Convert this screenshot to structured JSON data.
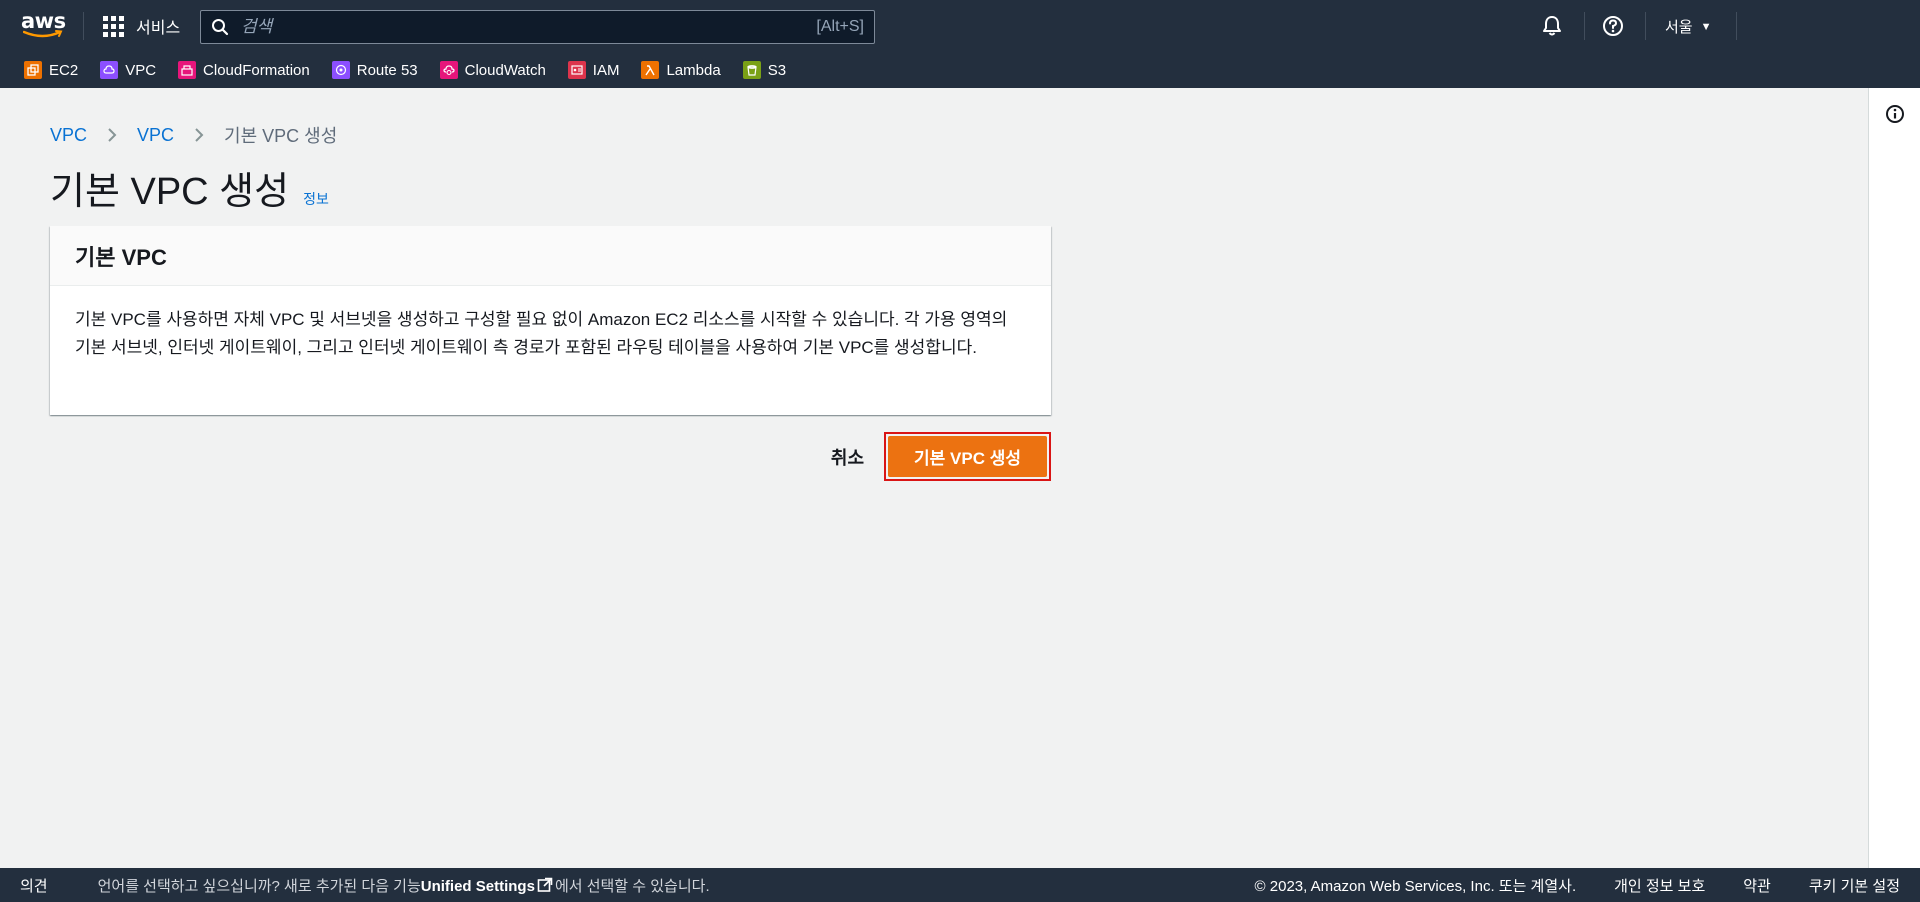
{
  "topnav": {
    "logo_text": "aws",
    "services_label": "서비스",
    "search_placeholder": "검색",
    "search_shortcut": "[Alt+S]",
    "region_label": "서울"
  },
  "favorites": [
    {
      "label": "EC2",
      "color": "#ed7100",
      "icon": "ec2-icon"
    },
    {
      "label": "VPC",
      "color": "#8c4fff",
      "icon": "vpc-icon"
    },
    {
      "label": "CloudFormation",
      "color": "#e7157b",
      "icon": "cloudformation-icon"
    },
    {
      "label": "Route 53",
      "color": "#8c4fff",
      "icon": "route53-icon"
    },
    {
      "label": "CloudWatch",
      "color": "#e7157b",
      "icon": "cloudwatch-icon"
    },
    {
      "label": "IAM",
      "color": "#dd344c",
      "icon": "iam-icon"
    },
    {
      "label": "Lambda",
      "color": "#ed7100",
      "icon": "lambda-icon"
    },
    {
      "label": "S3",
      "color": "#7aa116",
      "icon": "s3-icon"
    }
  ],
  "breadcrumb": {
    "items": [
      "VPC",
      "VPC"
    ],
    "current": "기본 VPC 생성"
  },
  "page": {
    "title": "기본 VPC 생성",
    "info_link": "정보"
  },
  "panel": {
    "header": "기본 VPC",
    "body": "기본 VPC를 사용하면 자체 VPC 및 서브넷을 생성하고 구성할 필요 없이 Amazon EC2 리소스를 시작할 수 있습니다. 각 가용 영역의 기본 서브넷, 인터넷 게이트웨이, 그리고 인터넷 게이트웨이 측 경로가 포함된 라우팅 테이블을 사용하여 기본 VPC를 생성합니다."
  },
  "actions": {
    "cancel": "취소",
    "primary": "기본 VPC 생성"
  },
  "footer": {
    "feedback": "의견",
    "lang_prefix": "언어를 선택하고 싶으십니까? 새로 추가된 다음 기능",
    "lang_link": "Unified Settings",
    "lang_suffix": "에서 선택할 수 있습니다.",
    "copyright": "© 2023, Amazon Web Services, Inc. 또는 계열사.",
    "privacy": "개인 정보 보호",
    "terms": "약관",
    "cookies": "쿠키 기본 설정"
  }
}
